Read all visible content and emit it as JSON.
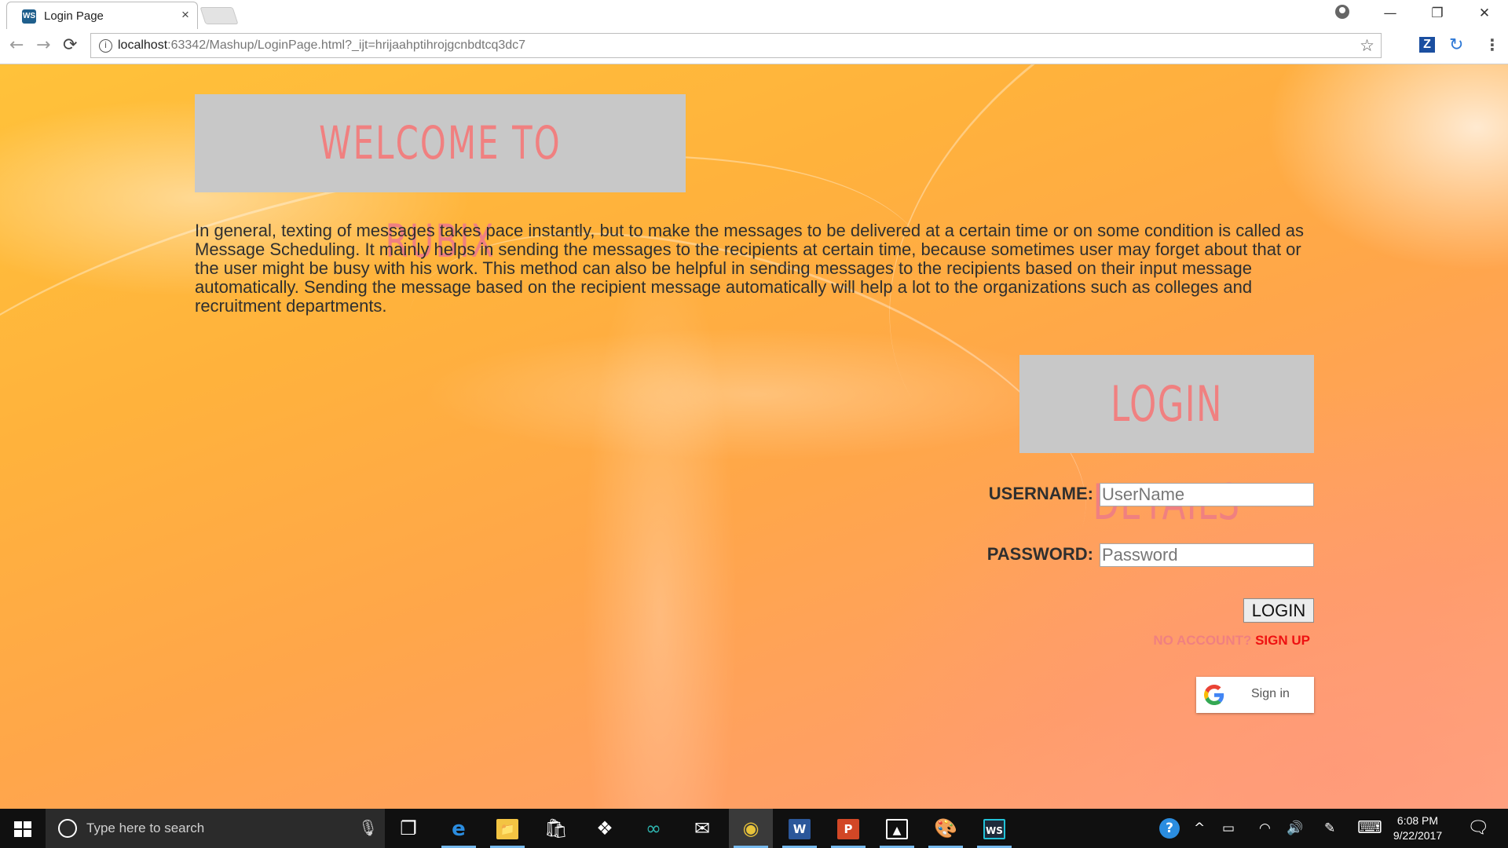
{
  "browser": {
    "tab_title": "Login Page",
    "tab_close": "×",
    "url_host": "localhost",
    "url_rest": ":63342/Mashup/LoginPage.html?_ijt=hrijaahptihrojgcnbdtcq3dc7",
    "window": {
      "minimize": "—",
      "maximize": "❐",
      "close": "✕"
    },
    "nav": {
      "back": "←",
      "forward": "→",
      "reload": "⟳"
    },
    "star": "☆",
    "extension_z": "Z",
    "extension_sync": "↻",
    "menu": "⋮",
    "info": "i"
  },
  "page": {
    "welcome_title": "WELCOME TO RUBIX",
    "intro_text": "In general, texting of messages takes pace instantly, but to make the messages to be delivered at a certain time or on some condition is called as Message Scheduling. It mainly helps in sending the messages to the recipients at certain time, because sometimes user may forget about that or the user might be busy with his work. This method can also be helpful in sending messages to the recipients based on their input message automatically. Sending the message based on the recipient message automatically will help a lot to the organizations such as colleges and recruitment departments.",
    "login_title": "LOGIN DETAILS",
    "username_label": "USERNAME:",
    "username_placeholder": "UserName",
    "password_label": "PASSWORD:",
    "password_placeholder": "Password",
    "login_button": "LOGIN",
    "no_account_text": "NO ACCOUNT?",
    "sign_up_link": "SIGN UP",
    "google_signin_label": "Sign in",
    "colors": {
      "title_pink": "#f08080",
      "signup_red": "#ee1111",
      "box_gray": "#c8c8c8"
    }
  },
  "taskbar": {
    "search_placeholder": "Type here to search",
    "mic": "🎙",
    "apps": [
      {
        "name": "task-view",
        "glyph": "❐"
      },
      {
        "name": "edge",
        "glyph": "e"
      },
      {
        "name": "file-explorer",
        "glyph": "📁"
      },
      {
        "name": "store",
        "glyph": "🛍"
      },
      {
        "name": "dropbox",
        "glyph": "❖"
      },
      {
        "name": "arduino",
        "glyph": "∞"
      },
      {
        "name": "mail",
        "glyph": "✉"
      },
      {
        "name": "chrome",
        "glyph": "◉"
      },
      {
        "name": "word",
        "glyph": "W"
      },
      {
        "name": "powerpoint",
        "glyph": "P"
      },
      {
        "name": "photos",
        "glyph": "▲"
      },
      {
        "name": "paint",
        "glyph": "🎨"
      },
      {
        "name": "webstorm",
        "glyph": "WS"
      }
    ],
    "tray": {
      "help": "?",
      "up_arrow": "^",
      "battery": "▭",
      "wifi": "◠",
      "volume": "🔊",
      "pen": "✎",
      "keyboard": "⌨"
    },
    "time": "6:08 PM",
    "date": "9/22/2017",
    "notification": "🗨"
  }
}
